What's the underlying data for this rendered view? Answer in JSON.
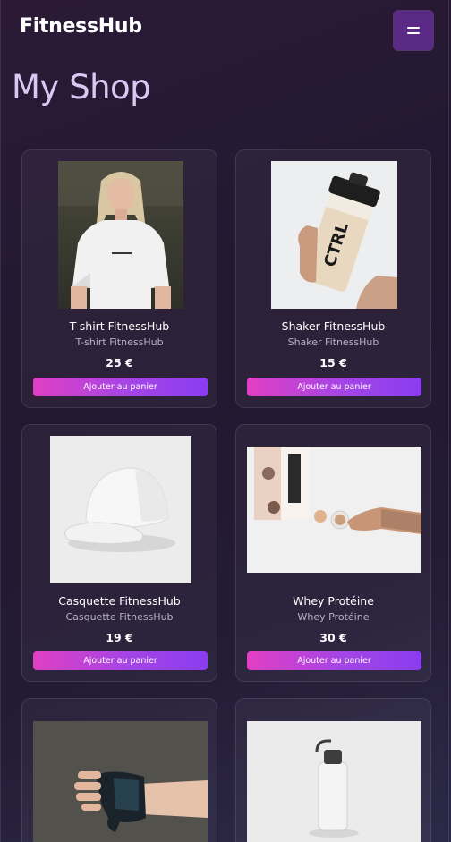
{
  "navbar": {
    "brand": "FitnessHub",
    "menu_icon": "hamburger-menu-icon"
  },
  "page": {
    "title": "My Shop"
  },
  "products": [
    {
      "title": "T-shirt FitnessHub",
      "subtitle": "T-shirt FitnessHub",
      "price": "25 €",
      "button_label": "Ajouter au panier"
    },
    {
      "title": "Shaker FitnessHub",
      "subtitle": "Shaker FitnessHub",
      "price": "15 €",
      "button_label": "Ajouter au panier"
    },
    {
      "title": "Casquette FitnessHub",
      "subtitle": "Casquette FitnessHub",
      "price": "19 €",
      "button_label": "Ajouter au panier"
    },
    {
      "title": "Whey Protéine",
      "subtitle": "Whey Protéine",
      "price": "30 €",
      "button_label": "Ajouter au panier"
    },
    {
      "title": "",
      "subtitle": "",
      "price": "",
      "button_label": ""
    },
    {
      "title": "",
      "subtitle": "",
      "price": "",
      "button_label": ""
    }
  ],
  "product_image_labels": {
    "shaker_brand": "CTRL"
  },
  "colors": {
    "background": "#241a33",
    "menu_button": "#5b2a86",
    "title": "#d8c8f2",
    "button_gradient_start": "#e13fc4",
    "button_gradient_end": "#8b3cf0"
  }
}
